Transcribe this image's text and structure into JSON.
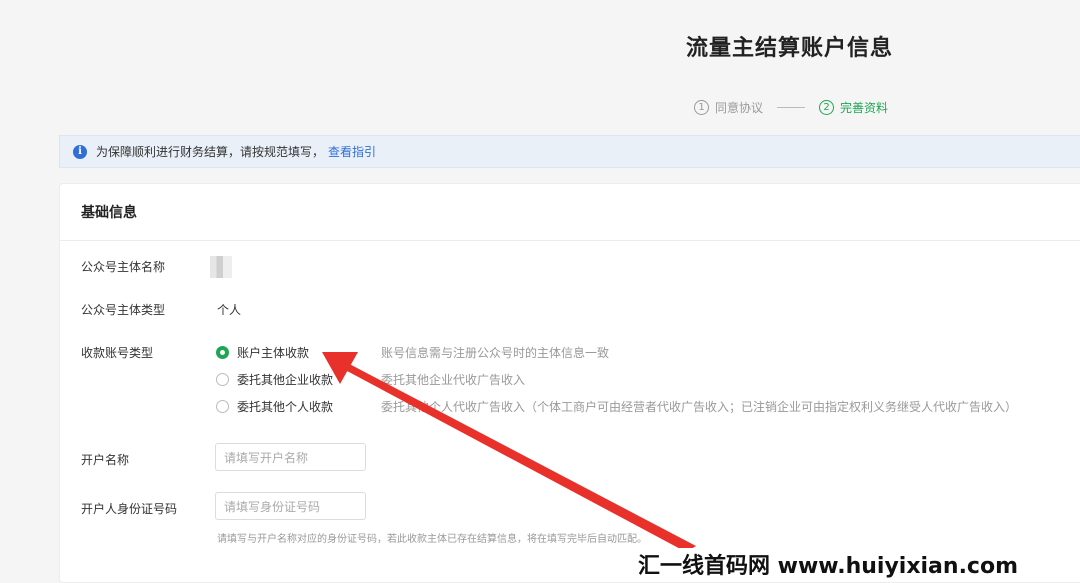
{
  "page_title": "流量主结算账户信息",
  "steps": [
    {
      "number": "1",
      "label": "同意协议"
    },
    {
      "number": "2",
      "label": "完善资料"
    }
  ],
  "notice": {
    "icon": "info-icon",
    "text": "为保障顺利进行财务结算，请按规范填写，",
    "link": "查看指引"
  },
  "section_title": "基础信息",
  "fields": {
    "entity_name_label": "公众号主体名称",
    "entity_type_label": "公众号主体类型",
    "entity_type_value": "个人",
    "account_type_label": "收款账号类型",
    "account_name_label": "开户名称",
    "account_name_placeholder": "请填写开户名称",
    "id_label": "开户人身份证号码",
    "id_placeholder": "请填写身份证号码",
    "id_hint": "请填写与开户名称对应的身份证号码，若此收款主体已存在结算信息，将在填写完毕后自动匹配。"
  },
  "account_options": [
    {
      "label": "账户主体收款",
      "desc": "账号信息需与注册公众号时的主体信息一致",
      "selected": true
    },
    {
      "label": "委托其他企业收款",
      "desc": "委托其他企业代收广告收入",
      "selected": false
    },
    {
      "label": "委托其他个人收款",
      "desc": "委托其他个人代收广告收入（个体工商户可由经营者代收广告收入；已注销企业可由指定权利义务继受人代收广告收入）",
      "selected": false
    }
  ],
  "watermark": "汇一线首码网 www.huiyixian.com",
  "colors": {
    "accent_green": "#1fa653",
    "link_blue": "#2f6fd6",
    "arrow_red": "#e8312a"
  }
}
